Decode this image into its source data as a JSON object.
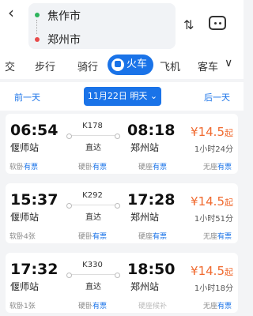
{
  "header": {
    "back_icon": "back-arrow-icon",
    "from_city": "焦作市",
    "to_city": "郑州市",
    "swap_icon": "swap-icon",
    "message_icon": "message-icon"
  },
  "tabs": [
    {
      "label": "交"
    },
    {
      "label": "步行"
    },
    {
      "label": "骑行"
    },
    {
      "label": "火车",
      "active": true
    },
    {
      "label": "飞机"
    },
    {
      "label": "客车"
    }
  ],
  "date_bar": {
    "prev_label": "前一天",
    "date_label": "11月22日 明天",
    "next_label": "后一天"
  },
  "trains": [
    {
      "depart_time": "06:54",
      "depart_station": "偃师站",
      "train_no": "K178",
      "type": "直达",
      "arrive_time": "08:18",
      "arrive_station": "郑州站",
      "price": "¥14.5",
      "price_suffix": "起",
      "duration": "1小时24分",
      "seats": [
        {
          "name": "软卧",
          "status": "有票"
        },
        {
          "name": "硬卧",
          "status": "有票"
        },
        {
          "name": "硬座",
          "status": "有票"
        },
        {
          "name": "无座",
          "status": "有票"
        }
      ]
    },
    {
      "depart_time": "15:37",
      "depart_station": "偃师站",
      "train_no": "K292",
      "type": "直达",
      "arrive_time": "17:28",
      "arrive_station": "郑州站",
      "price": "¥14.5",
      "price_suffix": "起",
      "duration": "1小时51分",
      "seats": [
        {
          "name": "软卧",
          "status": "4张"
        },
        {
          "name": "硬卧",
          "status": "有票"
        },
        {
          "name": "硬座",
          "status": "有票"
        },
        {
          "name": "无座",
          "status": "有票"
        }
      ]
    },
    {
      "depart_time": "17:32",
      "depart_station": "偃师站",
      "train_no": "K330",
      "type": "直达",
      "arrive_time": "18:50",
      "arrive_station": "郑州站",
      "price": "¥14.5",
      "price_suffix": "起",
      "duration": "1小时18分",
      "seats": [
        {
          "name": "软卧",
          "status": "1张"
        },
        {
          "name": "硬卧",
          "status": "有票"
        },
        {
          "name": "硬座",
          "status": "候补",
          "grey": true
        },
        {
          "name": "无座",
          "status": "有票"
        }
      ]
    }
  ]
}
